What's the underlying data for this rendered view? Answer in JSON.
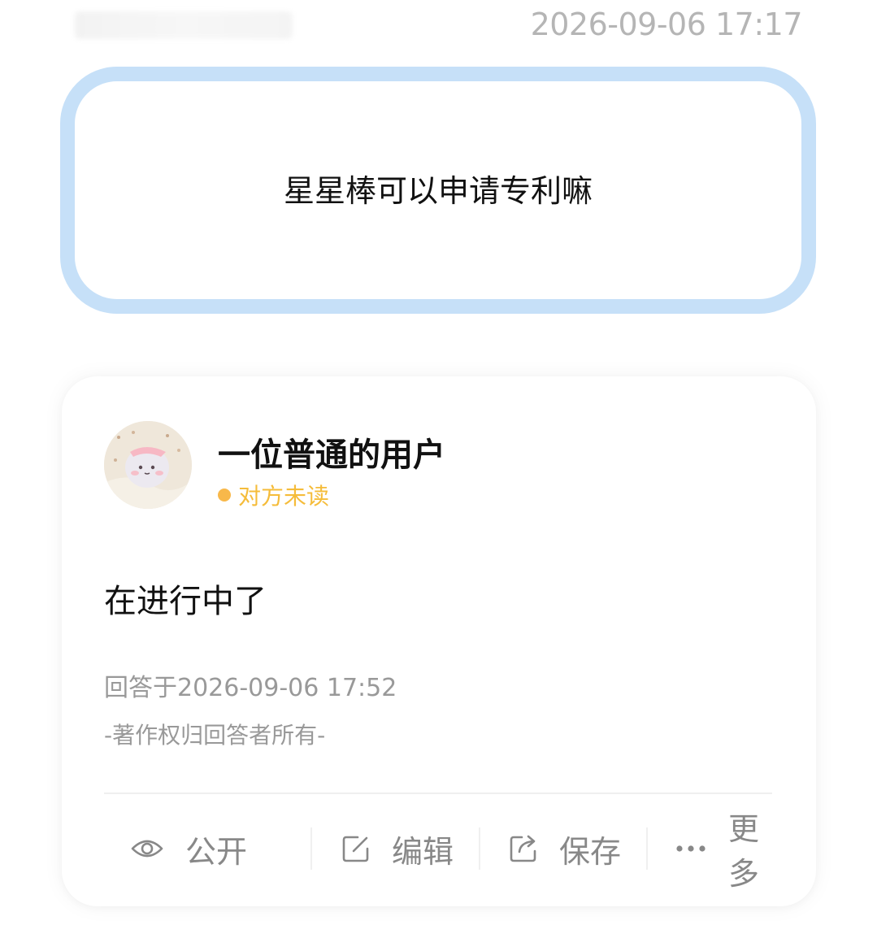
{
  "header": {
    "timestamp": "2026-09-06 17:17"
  },
  "question": {
    "text": "星星棒可以申请专利嘛"
  },
  "answer": {
    "username": "一位普通的用户",
    "status": "对方未读",
    "text": "在进行中了",
    "answered_at": "回答于2026-09-06 17:52",
    "copyright": "-著作权归回答者所有-"
  },
  "actions": [
    {
      "label": "公开",
      "icon": "eye-icon"
    },
    {
      "label": "编辑",
      "icon": "edit-icon"
    },
    {
      "label": "保存",
      "icon": "share-icon"
    },
    {
      "label": "更多",
      "icon": "more-icon"
    }
  ],
  "colors": {
    "question_border": "#c6e0f8",
    "status": "#f5bc3a",
    "muted_text": "#999999"
  }
}
